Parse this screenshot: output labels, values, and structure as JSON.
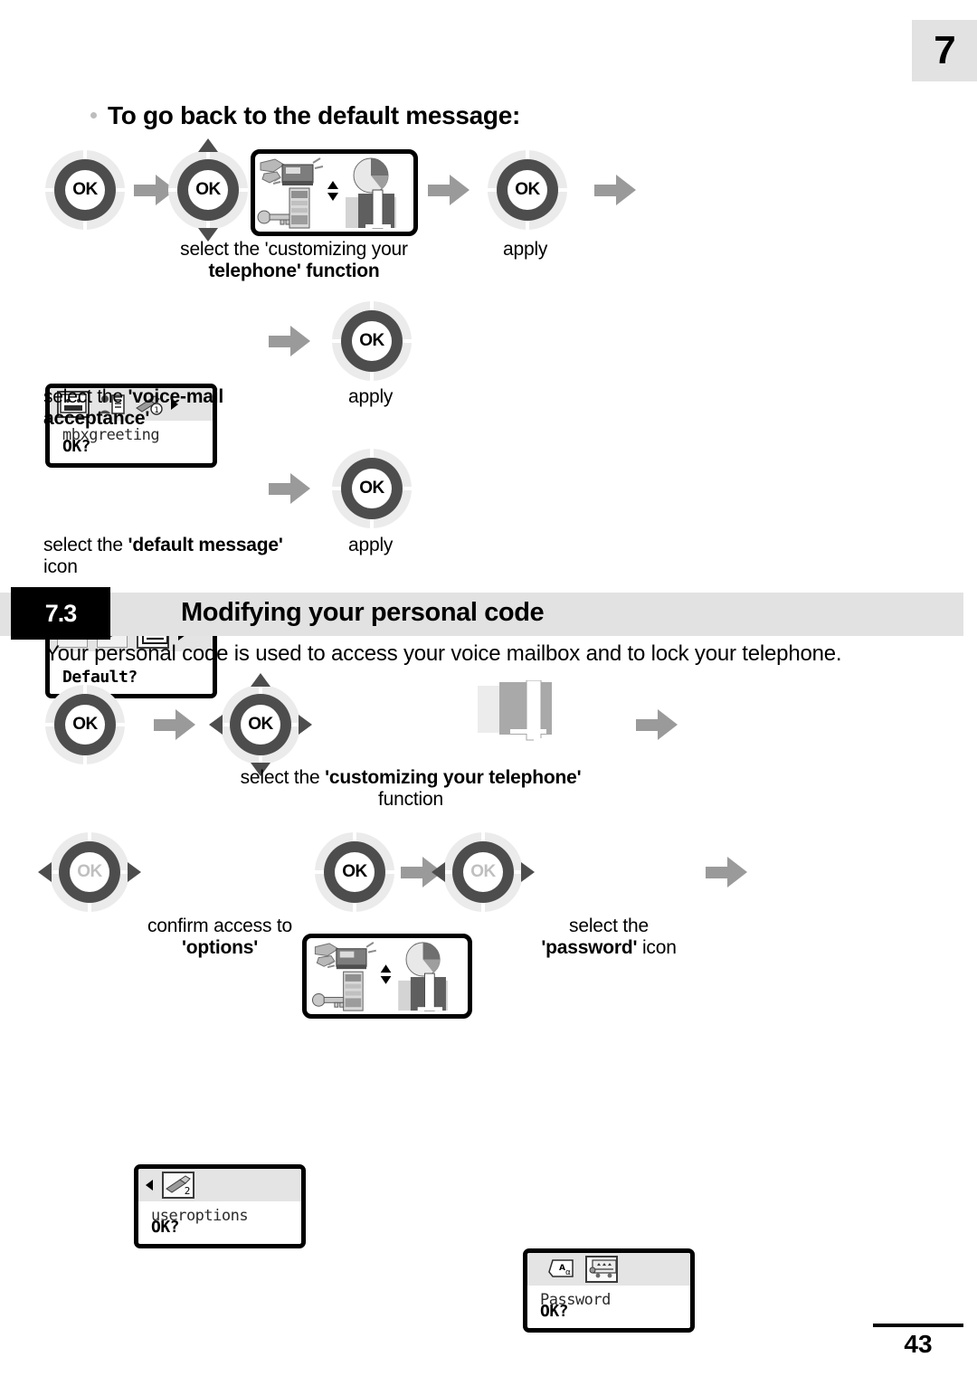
{
  "chapter_tab": {
    "number": "7"
  },
  "headings": {
    "bullet_heading": "To go back to the default message:"
  },
  "section": {
    "number": "7.3",
    "title": "Modifying your personal code",
    "intro": "Your personal code is used to access your voice mailbox and to lock your telephone."
  },
  "wheels": {
    "ok_label": "OK"
  },
  "flow_default_message": {
    "step1_caption_plain": "select the ",
    "step1_caption_bold": "'customizing your telephone'",
    "step1_caption_tail": " function",
    "step1_line1": "select the 'customizing your",
    "step1_line2": "telephone' function",
    "apply_label": "apply",
    "screen_mbx": {
      "line1": "mbxgreeting",
      "line2": "OK?",
      "icons": [
        "cassette-icon",
        "contacts-icon",
        "settings-tools-icon"
      ],
      "badge": "1",
      "selected_index": 0
    },
    "caption_voicemail_plain": "select the ",
    "caption_voicemail_bold": "'voice-mail acceptance'",
    "screen_default": {
      "line1": "",
      "line2": "Default?",
      "icons": [
        "record-icon",
        "play-icon",
        "list-message-icon"
      ],
      "selected_index": 2
    },
    "caption_default_plain": "select the ",
    "caption_default_bold": "'default message'",
    "caption_default_tail": " icon"
  },
  "flow_personal_code": {
    "step1_caption_plain": "select the ",
    "step1_caption_bold": "'customizing your telephone'",
    "step1_caption_tail": "function",
    "screen_useroptions": {
      "line1": "useroptions",
      "line2": "OK?",
      "icons": [
        "settings-tools-2-icon"
      ],
      "badge": "2",
      "selected_index": 0
    },
    "caption_options_plain": "confirm access to",
    "caption_options_bold": "'options'",
    "screen_password": {
      "line1": "Password",
      "line2": "OK?",
      "icons": [
        "alpha-entry-icon",
        "keypad-icon"
      ],
      "selected_index": 1
    },
    "caption_password_plain": "select the",
    "caption_password_bold": "'password'",
    "caption_password_tail": " icon"
  },
  "footer": {
    "page_number": "43"
  },
  "colors": {
    "tab_gray": "#e2e2e2",
    "band_gray": "#e2e2e2",
    "arrow_gray": "#9a9a9a",
    "wheel_dark": "#4d4d4d",
    "wheel_light": "#ebebeb",
    "lcd_bar": "#e4e4e4"
  }
}
